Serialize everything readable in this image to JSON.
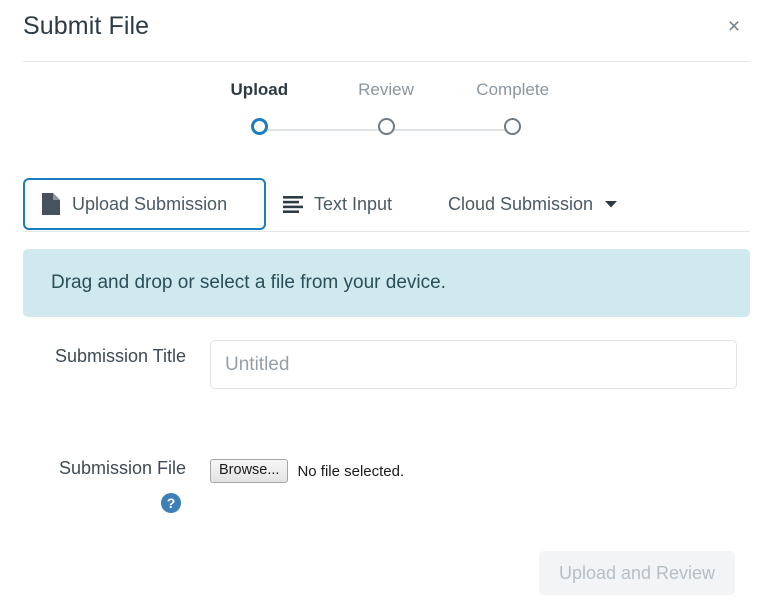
{
  "dialog": {
    "title": "Submit File",
    "close_label": "×"
  },
  "stepper": {
    "steps": [
      {
        "label": "Upload",
        "state": "active"
      },
      {
        "label": "Review",
        "state": "inactive"
      },
      {
        "label": "Complete",
        "state": "inactive"
      }
    ],
    "active_color": "#1c7cc0",
    "inactive_color": "#707a83"
  },
  "tabs": [
    {
      "label": "Upload Submission",
      "icon": "document-icon",
      "selected": true
    },
    {
      "label": "Text Input",
      "icon": "text-lines-icon",
      "selected": false
    },
    {
      "label": "Cloud Submission",
      "icon": "chevron-down-icon",
      "selected": false
    }
  ],
  "drop_zone": {
    "message": "Drag and drop or select a file from your device.",
    "background": "#cfe9ef",
    "text_color": "#2a4f59"
  },
  "form": {
    "submission_title": {
      "label": "Submission Title",
      "value": "",
      "placeholder": "Untitled"
    },
    "submission_file": {
      "label": "Submission File",
      "browse_label": "Browse...",
      "status": "No file selected.",
      "help_icon": "help-circle-icon"
    }
  },
  "footer": {
    "submit_label": "Upload and Review",
    "disabled": true
  }
}
